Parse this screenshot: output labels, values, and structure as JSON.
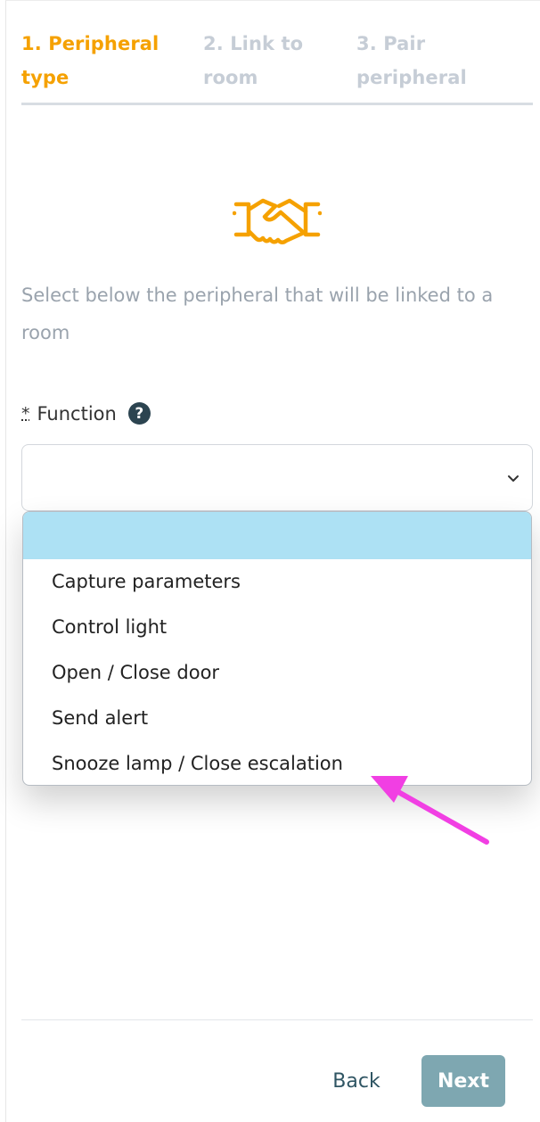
{
  "stepper": {
    "step1_line1": "1. Peripheral",
    "step1_line2": "type",
    "step2_line1": "2. Link to",
    "step2_line2": "room",
    "step3_line1": "3. Pair",
    "step3_line2": "peripheral",
    "active_color": "#f5a100",
    "inactive_color": "#c6cdd6"
  },
  "hero": {
    "icon": "handshake-icon",
    "color": "#f5a100"
  },
  "intro_text": "Select below the peripheral that will be linked to a room",
  "function_field": {
    "required_marker": "*",
    "label": "Function",
    "help_icon": "question-circle-icon",
    "help_glyph": "?",
    "value": "",
    "options": [
      "",
      "Capture parameters",
      "Control light",
      "Open / Close door",
      "Send alert",
      "Snooze lamp / Close escalation"
    ],
    "highlight_color": "#ade1f4"
  },
  "annotation": {
    "icon": "pointer-arrow-icon",
    "color": "#f13fe3"
  },
  "footer": {
    "back_label": "Back",
    "next_label": "Next",
    "next_color": "#7ea7b1"
  }
}
